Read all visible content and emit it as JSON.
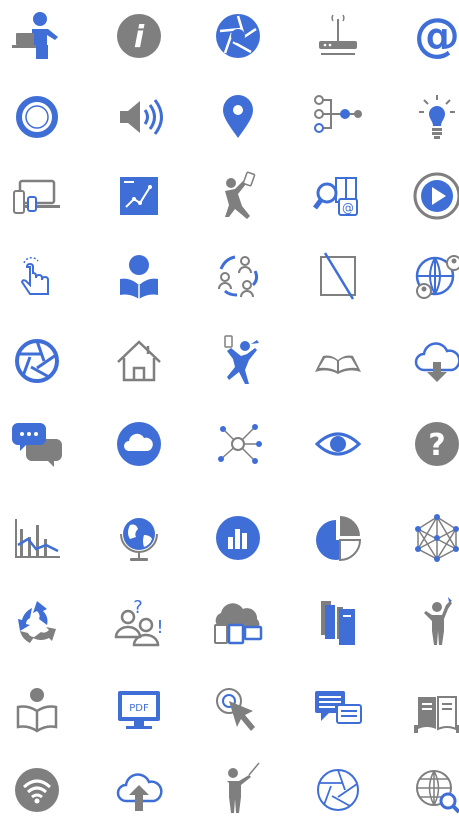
{
  "colors": {
    "blue": "#3f6fd6",
    "gray": "#7f7f7f",
    "background": "#ffffff"
  },
  "icons": [
    [
      "presenter-laptop-icon",
      "info-icon",
      "aperture-icon",
      "router-icon",
      "at-sign-icon"
    ],
    [
      "ring-icon",
      "speaker-icon",
      "location-pin-icon",
      "network-nodes-icon",
      "lightbulb-icon"
    ],
    [
      "devices-icon",
      "chart-board-icon",
      "person-phone-icon",
      "search-book-icon",
      "play-circle-icon"
    ],
    [
      "touch-hand-icon",
      "reader-icon",
      "people-cycle-icon",
      "crop-icon",
      "globe-people-icon"
    ],
    [
      "shutter-icon",
      "home-icon",
      "jumping-person-icon",
      "open-book-icon",
      "cloud-download-icon"
    ],
    [
      "chat-bubbles-icon",
      "cloud-circle-icon",
      "molecule-icon",
      "eye-icon",
      "question-icon"
    ],
    [
      "line-chart-icon",
      "globe-stand-icon",
      "bar-chart-circle-icon",
      "pie-chart-icon",
      "mesh-network-icon"
    ],
    [
      "recycle-arrows-icon",
      "people-question-icon",
      "cloud-devices-icon",
      "books-icon",
      "person-wave-icon"
    ],
    [
      "reading-person-icon",
      "pdf-monitor-icon",
      "cursor-click-icon",
      "message-boxes-icon",
      "library-book-icon"
    ],
    [
      "wifi-circle-icon",
      "cloud-upload-icon",
      "teacher-pointer-icon",
      "aperture-outline-icon",
      "globe-search-icon"
    ]
  ],
  "labels": {
    "at_sign": "@",
    "info": "i",
    "question": "?",
    "question_mark": "?",
    "exclaim": "!",
    "pdf": "PDF"
  }
}
